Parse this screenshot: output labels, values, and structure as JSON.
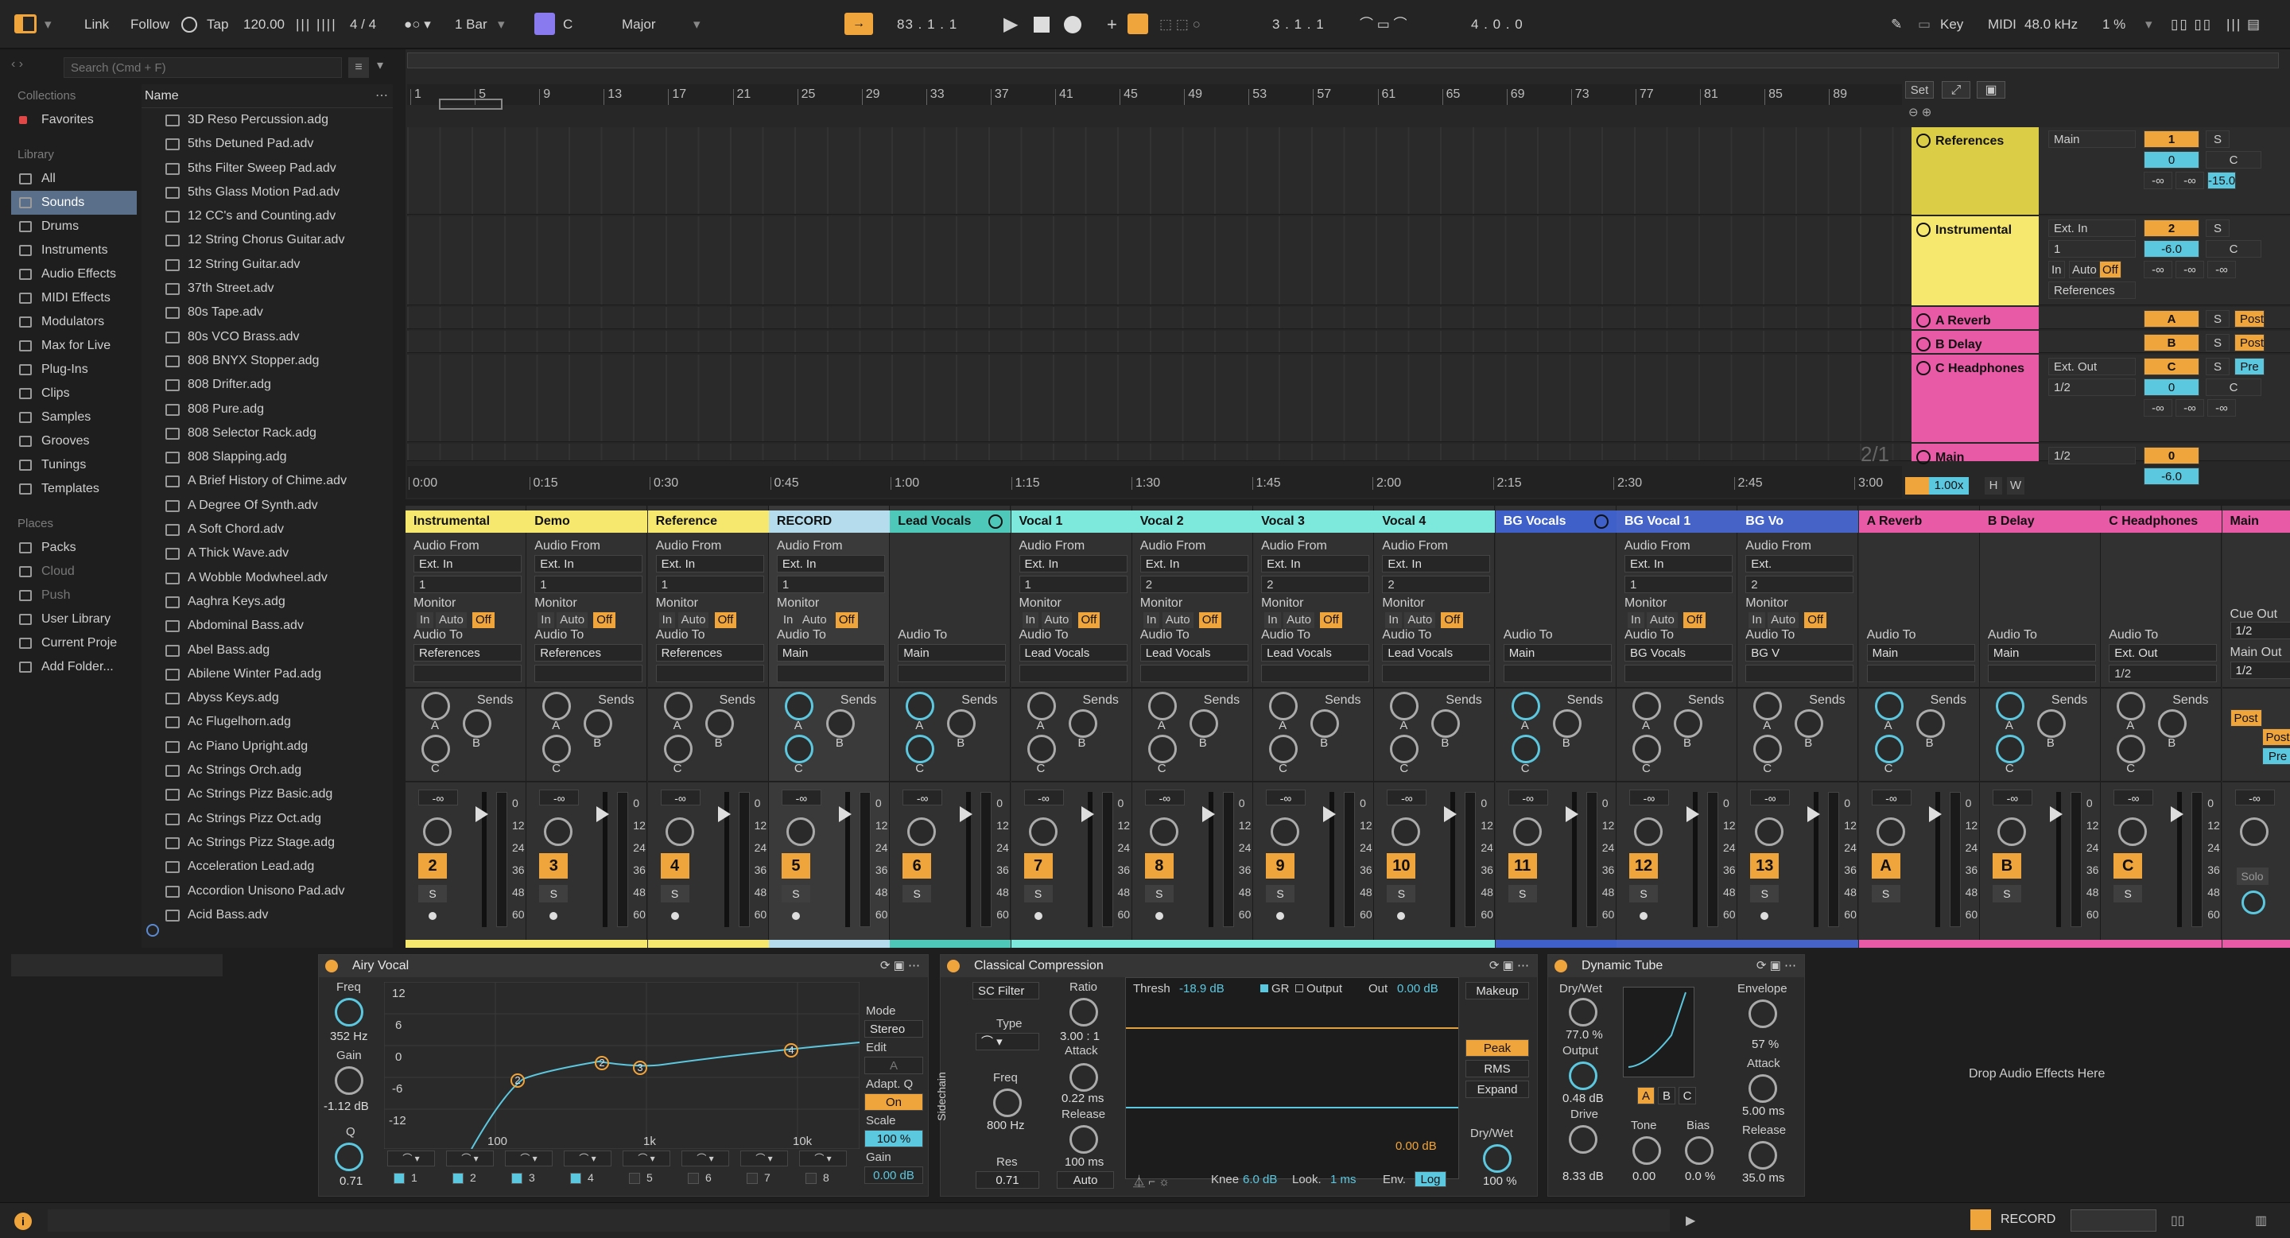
{
  "colors": {
    "accent": "#f0a43c",
    "blue": "#5bc8e0",
    "yellow": "#f6e86e",
    "pink": "#e85aa6",
    "red": "#e04848",
    "teal": "#7de8dc",
    "navy": "#4664c8"
  },
  "transport": {
    "link": "Link",
    "follow": "Follow",
    "tap": "Tap",
    "tempo": "120.00",
    "sig": "4 / 4",
    "quant": "1 Bar",
    "key": "C",
    "scale": "Major",
    "position": "83 .  1 .  1",
    "loop_start": "3 .  1 .  1",
    "loop_len": "4 .  0 .  0",
    "key_btn": "Key",
    "midi_btn": "MIDI",
    "sample_rate": "48.0 kHz",
    "cpu": "1 %"
  },
  "browser": {
    "search_placeholder": "Search (Cmd + F)",
    "collections_label": "Collections",
    "favorites": "Favorites",
    "library_label": "Library",
    "library": [
      "All",
      "Sounds",
      "Drums",
      "Instruments",
      "Audio Effects",
      "MIDI Effects",
      "Modulators",
      "Max for Live",
      "Plug-Ins",
      "Clips",
      "Samples",
      "Grooves",
      "Tunings",
      "Templates"
    ],
    "places_label": "Places",
    "places": [
      "Packs",
      "Cloud",
      "Push",
      "User Library",
      "Current Proje",
      "Add Folder..."
    ],
    "name_header": "Name",
    "files": [
      "3D Reso Percussion.adg",
      "5ths Detuned Pad.adv",
      "5ths Filter Sweep Pad.adv",
      "5ths Glass Motion Pad.adv",
      "12 CC's and Counting.adv",
      "12 String Chorus Guitar.adv",
      "12 String Guitar.adv",
      "37th Street.adv",
      "80s Tape.adv",
      "80s VCO Brass.adv",
      "808 BNYX Stopper.adg",
      "808 Drifter.adg",
      "808 Pure.adg",
      "808 Selector Rack.adg",
      "808 Slapping.adg",
      "A Brief History of Chime.adv",
      "A Degree Of Synth.adv",
      "A Soft Chord.adv",
      "A Thick Wave.adv",
      "A Wobble Modwheel.adv",
      "Aaghra Keys.adg",
      "Abdominal Bass.adv",
      "Abel Bass.adg",
      "Abilene Winter Pad.adg",
      "Abyss Keys.adg",
      "Ac Flugelhorn.adg",
      "Ac Piano Upright.adg",
      "Ac Strings Orch.adg",
      "Ac Strings Pizz Basic.adg",
      "Ac Strings Pizz Oct.adg",
      "Ac Strings Pizz Stage.adg",
      "Acceleration Lead.adg",
      "Accordion Unisono Pad.adv",
      "Acid Bass.adv"
    ]
  },
  "arrangement": {
    "bars": [
      "1",
      "5",
      "9",
      "13",
      "17",
      "21",
      "25",
      "29",
      "33",
      "37",
      "41",
      "45",
      "49",
      "53",
      "57",
      "61",
      "65",
      "69",
      "73",
      "77",
      "81",
      "85",
      "89"
    ],
    "times": [
      "0:00",
      "0:15",
      "0:30",
      "0:45",
      "1:00",
      "1:15",
      "1:30",
      "1:45",
      "2:00",
      "2:15",
      "2:30",
      "2:45",
      "3:00"
    ],
    "set_btn": "Set",
    "page": "2/1",
    "zoom": "1.00x",
    "h": "H",
    "w": "W",
    "tracks": [
      {
        "name": "References",
        "io1": "Main",
        "n": "1",
        "s": "S",
        "v1": "0",
        "v2": "C",
        "v3": "-∞",
        "v4": "-∞",
        "v5": "-15.0"
      },
      {
        "name": "Instrumental",
        "io1": "Ext. In",
        "io2": "1",
        "n": "2",
        "s": "S",
        "v1": "-6.0",
        "v2": "C",
        "mon": [
          "In",
          "Auto",
          "Off"
        ],
        "out": "References",
        "v3": "-∞",
        "v4": "-∞",
        "v5": "-∞"
      },
      {
        "name": "A Reverb",
        "n": "A",
        "s": "S",
        "post": "Post"
      },
      {
        "name": "B Delay",
        "n": "B",
        "s": "S",
        "post": "Post"
      },
      {
        "name": "C Headphones",
        "io1": "Ext. Out",
        "io2": "1/2",
        "n": "C",
        "s": "S",
        "pre": "Pre",
        "v1": "0",
        "v2": "C",
        "v3": "-∞",
        "v4": "-∞",
        "v5": "-∞"
      },
      {
        "name": "Main",
        "io1": "1/2",
        "n": "0",
        "v1": "-6.0"
      }
    ]
  },
  "mixer": {
    "audio_from": "Audio From",
    "audio_to": "Audio To",
    "monitor": "Monitor",
    "sends": "Sends",
    "mon_in": "In",
    "mon_auto": "Auto",
    "mon_off": "Off",
    "vol": "-∞",
    "ka": "A",
    "kb": "B",
    "kc": "C",
    "scale": [
      "0",
      "12",
      "24",
      "36",
      "48",
      "60"
    ],
    "cue_out": "Cue Out",
    "cue_val": "1/2",
    "main_out": "Main Out",
    "main_val": "1/2",
    "solo": "Solo",
    "strips": [
      {
        "name": "Instrumental",
        "from": "Ext. In",
        "ch": "1",
        "to": "References",
        "num": "2",
        "color": "#f6e86e"
      },
      {
        "name": "Demo",
        "from": "Ext. In",
        "ch": "1",
        "to": "References",
        "num": "3",
        "color": "#f6e86e"
      },
      {
        "name": "Reference",
        "from": "Ext. In",
        "ch": "1",
        "to": "References",
        "num": "4",
        "color": "#f6e86e"
      },
      {
        "name": "RECORD",
        "from": "Ext. In",
        "ch": "1",
        "to": "Main",
        "num": "5",
        "color": "#b4dcec"
      },
      {
        "name": "Lead Vocals",
        "to": "Main",
        "num": "6",
        "color": "#4ec8b8",
        "group": true
      },
      {
        "name": "Vocal 1",
        "from": "Ext. In",
        "ch": "1",
        "to": "Lead Vocals",
        "num": "7",
        "color": "#7de8dc"
      },
      {
        "name": "Vocal 2",
        "from": "Ext. In",
        "ch": "2",
        "to": "Lead Vocals",
        "num": "8",
        "color": "#7de8dc"
      },
      {
        "name": "Vocal 3",
        "from": "Ext. In",
        "ch": "2",
        "to": "Lead Vocals",
        "num": "9",
        "color": "#7de8dc"
      },
      {
        "name": "Vocal 4",
        "from": "Ext. In",
        "ch": "2",
        "to": "Lead Vocals",
        "num": "10",
        "color": "#7de8dc"
      },
      {
        "name": "BG Vocals",
        "to": "Main",
        "num": "11",
        "color": "#3e60c8",
        "group": true
      },
      {
        "name": "BG Vocal 1",
        "from": "Ext. In",
        "ch": "1",
        "to": "BG Vocals",
        "num": "12",
        "color": "#4664c8"
      },
      {
        "name": "BG Vo",
        "from": "Ext.",
        "ch": "2",
        "to": "BG V",
        "num": "13",
        "color": "#4664c8"
      },
      {
        "name": "A Reverb",
        "to": "Main",
        "num": "A",
        "color": "#e85aa6"
      },
      {
        "name": "B Delay",
        "to": "Main",
        "num": "B",
        "color": "#e85aa6"
      },
      {
        "name": "C Headphones",
        "to": "Ext. Out",
        "ch": "1/2",
        "num": "C",
        "color": "#e85aa6"
      },
      {
        "name": "Main",
        "num": "",
        "color": "#e85aa6"
      }
    ],
    "post": "Post",
    "pre": "Pre"
  },
  "devices": {
    "eq": {
      "title": "Airy Vocal",
      "freq": "Freq",
      "freq_v": "352 Hz",
      "gain": "Gain",
      "gain_v": "-1.12 dB",
      "q": "Q",
      "q_v": "0.71",
      "db": [
        "12",
        "6",
        "0",
        "-6",
        "-12"
      ],
      "hz": [
        "100",
        "1k",
        "10k"
      ],
      "mode": "Mode",
      "mode_v": "Stereo",
      "edit": "Edit",
      "edit_v": "A",
      "adapt": "Adapt. Q",
      "adapt_v": "On",
      "scale": "Scale",
      "scale_v": "100 %",
      "gain2": "Gain",
      "gain2_v": "0.00 dB",
      "bands": [
        "1",
        "2",
        "3",
        "4",
        "5",
        "6",
        "7",
        "8"
      ],
      "points": [
        "2",
        "2",
        "3",
        "4"
      ]
    },
    "comp": {
      "title": "Classical Compression",
      "sc": "SC Filter",
      "type": "Type",
      "freq": "Freq",
      "freq_v": "800 Hz",
      "res": "Res",
      "res_v": "0.71",
      "sidechain": "Sidechain",
      "ratio": "Ratio",
      "ratio_v": "3.00 : 1",
      "attack": "Attack",
      "attack_v": "0.22 ms",
      "release": "Release",
      "release_v": "100 ms",
      "auto": "Auto",
      "thresh": "Thresh",
      "thresh_v": "-18.9 dB",
      "gr": "GR",
      "output": "Output",
      "out": "Out",
      "out_v": "0.00 dB",
      "graph_v": "0.00 dB",
      "knee": "Knee",
      "knee_v": "6.0 dB",
      "look": "Look.",
      "look_v": "1 ms",
      "env": "Env.",
      "env_v": "Log",
      "makeup": "Makeup",
      "peak": "Peak",
      "rms": "RMS",
      "expand": "Expand",
      "drywet": "Dry/Wet",
      "drywet_v": "100 %"
    },
    "tube": {
      "title": "Dynamic Tube",
      "drywet": "Dry/Wet",
      "drywet_v": "77.0 %",
      "output": "Output",
      "output_v": "0.48 dB",
      "drive": "Drive",
      "drive_v": "8.33 dB",
      "tone": "Tone",
      "tone_v": "0.00",
      "bias": "Bias",
      "bias_v": "0.0 %",
      "envelope": "Envelope",
      "envelope_v": "57 %",
      "attack": "Attack",
      "attack_v": "5.00 ms",
      "release": "Release",
      "release_v": "35.0 ms",
      "a": "A",
      "b": "B",
      "c": "C"
    },
    "drop": "Drop Audio Effects Here"
  },
  "status": {
    "record": "RECORD"
  }
}
